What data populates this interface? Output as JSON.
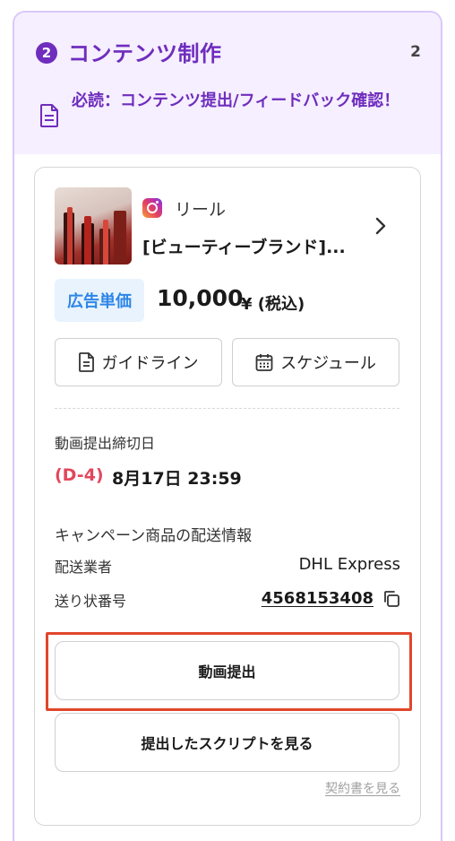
{
  "section": {
    "step_number": "2",
    "title": "コンテンツ制作",
    "count": "2",
    "notice_text": "必読：コンテンツ提出/フィードバック確認！"
  },
  "card": {
    "post_type": "リール",
    "platform_icon": "instagram-icon",
    "campaign_title": "[ビューティーブランド]...",
    "price_badge": "広告単価",
    "price_amount": "10,000",
    "price_unit": "¥ (税込)",
    "guideline_label": "ガイドライン",
    "schedule_label": "スケジュール",
    "deadline_label": "動画提出締切日",
    "deadline_count": "(D-4)",
    "deadline_date": "8月17日 23:59",
    "shipping_title": "キャンペーン商品の配送情報",
    "carrier_label": "配送業者",
    "carrier_value": "DHL Express",
    "tracking_label": "送り状番号",
    "tracking_value": "4568153408",
    "submit_button": "動画提出",
    "script_button": "提出したスクリプトを見る",
    "contract_link": "契約書を見る"
  },
  "colors": {
    "accent_purple": "#6f2dbd",
    "header_bg": "#f5efff",
    "price_blue": "#2f86e6",
    "deadline_red": "#e2475b",
    "highlight_red": "#e1462b"
  }
}
